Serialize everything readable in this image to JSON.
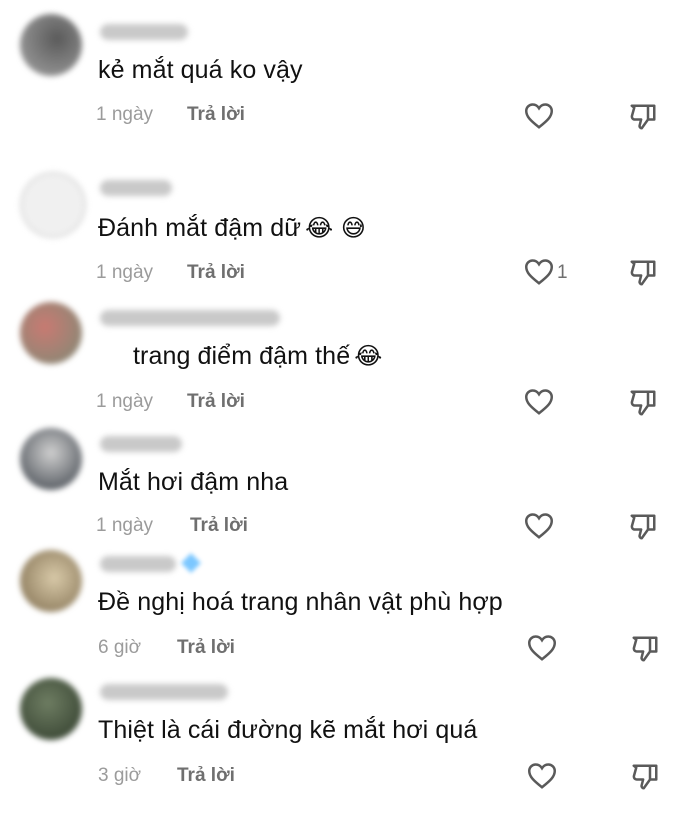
{
  "comments": [
    {
      "text": "kẻ mắt quá ko vậy",
      "emoji": "",
      "time": "1 ngày",
      "reply": "Trả lời",
      "likes": "",
      "avatar_color": "#8d8d8d"
    },
    {
      "text": "Đánh mắt đậm dữ",
      "emoji": "😂 😅",
      "time": "1 ngày",
      "reply": "Trả lời",
      "likes": "1",
      "avatar_color": "#dcdcdc"
    },
    {
      "text": "trang điểm đậm thế",
      "emoji": "😂",
      "time": "1 ngày",
      "reply": "Trả lời",
      "likes": "",
      "avatar_color": "#b0766f"
    },
    {
      "text": "Mắt hơi đậm nha",
      "emoji": "",
      "time": "1 ngày",
      "reply": "Trả lời",
      "likes": "",
      "avatar_color": "#5a6068"
    },
    {
      "text": "Đề nghị hoá trang nhân vật phù hợp",
      "emoji": "",
      "time": "6 giờ",
      "reply": "Trả lời",
      "likes": "",
      "avatar_color": "#a38e6c"
    },
    {
      "text": "Thiệt là cái đường kẽ mắt hơi quá",
      "emoji": "",
      "time": "3 giờ",
      "reply": "Trả lời",
      "likes": "",
      "avatar_color": "#4f6b45"
    }
  ],
  "icons": {
    "like": "heart-outline-icon",
    "dislike": "thumbs-down-outline-icon"
  }
}
